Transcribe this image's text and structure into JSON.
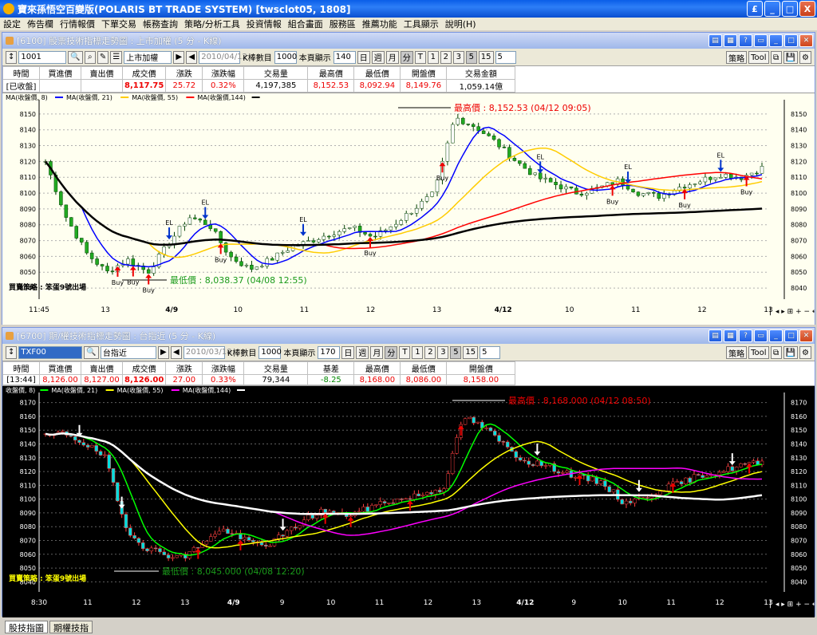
{
  "window": {
    "title": "寶來孫悟空百變版(POLARIS BT TRADE SYSTEM)  [twsclot05, 1808]",
    "buttons": [
      "£",
      "_",
      "□",
      "X"
    ]
  },
  "menu": [
    "設定",
    "佈告欄",
    "行情報價",
    "下單交易",
    "帳務查詢",
    "策略/分析工具",
    "投資情報",
    "組合畫面",
    "服務區",
    "推薦功能",
    "工具顯示",
    "說明(H)"
  ],
  "top": {
    "title": "[6100] 股票技術指標走勢圖 : 上市加權 (5 分 - K線)",
    "code": "1001",
    "name": "上市加權",
    "date": "2010/04/12",
    "kbar_label": "K棒數目",
    "kbar_value": "1000",
    "page_label": "本頁顯示",
    "page_value": "140",
    "periods": [
      "日",
      "週",
      "月",
      "分",
      "T",
      "1",
      "2",
      "3",
      "5",
      "15"
    ],
    "period_select": "5",
    "right_btns": [
      "策略",
      "Tool"
    ],
    "quote_headers": [
      "時間",
      "買進價",
      "賣出價",
      "成交價",
      "漲跌",
      "漲跌幅",
      "交易量",
      "最高價",
      "最低價",
      "開盤價",
      "交易金額"
    ],
    "quote_values": [
      "[已收盤]",
      "",
      "",
      "8,117.75",
      "25.72",
      "0.32%",
      "4,197,385",
      "8,152.53",
      "8,092.94",
      "8,149.76",
      "1,059.14億"
    ],
    "legend": [
      "MA(收盤價, 8)",
      "MA(收盤價, 21)",
      "MA(收盤價, 55)",
      "MA(收盤價,144)"
    ],
    "high_label": "最高價 : 8,152.53 (04/12 09:05)",
    "low_label": "最低價 : 8,038.37 (04/08 12:55)",
    "strategy_label": "買賣策略 : 笨蛋9號出場",
    "x_labels": [
      "11:45",
      "13",
      "4/9",
      "10",
      "11",
      "12",
      "13",
      "4/12",
      "10",
      "11",
      "12",
      "13"
    ],
    "y_ticks": [
      "8150",
      "8140",
      "8130",
      "8120",
      "8110",
      "8100",
      "8090",
      "8080",
      "8070",
      "8060",
      "8050",
      "8040"
    ],
    "signals": [
      "Buy",
      "Buy",
      "EL",
      "Buy",
      "EL",
      "EL",
      "Buy",
      "EL",
      "Buy",
      "EL",
      "EL",
      "Buy",
      "Buy",
      "EL",
      "Buy"
    ]
  },
  "bottom": {
    "title": "[6700] 期/權技術指標走勢圖 : 台指近 (5 分 - K線)",
    "code": "TXF00",
    "name": "台指近",
    "date": "2010/03/18",
    "kbar_label": "K棒數目",
    "kbar_value": "1000",
    "page_label": "本頁顯示",
    "page_value": "170",
    "periods": [
      "日",
      "週",
      "月",
      "分",
      "T",
      "1",
      "2",
      "3",
      "5",
      "15"
    ],
    "period_select": "5",
    "right_btns": [
      "策略",
      "Tool"
    ],
    "quote_headers": [
      "時間",
      "買進價",
      "賣出價",
      "成交價",
      "漲跌",
      "漲跌幅",
      "交易量",
      "基差",
      "最高價",
      "最低價",
      "開盤價"
    ],
    "quote_values": [
      "[13:44]",
      "8,126.00",
      "8,127.00",
      "8,126.00",
      "27.00",
      "0.33%",
      "79,344",
      "-8.25",
      "8,168.00",
      "8,086.00",
      "8,158.00"
    ],
    "legend": [
      "收盤價, 8)",
      "MA(收盤價, 21)",
      "MA(收盤價, 55)",
      "MA(收盤價,144)"
    ],
    "high_label": "最高價 : 8,168.000 (04/12 08:50)",
    "low_label": "最低價 : 8,045.000 (04/08 12:20)",
    "strategy_label": "買賣策略 : 笨蛋9號出場",
    "x_labels": [
      "8:30",
      "11",
      "12",
      "13",
      "4/9",
      "9",
      "10",
      "11",
      "12",
      "13",
      "4/12",
      "9",
      "10",
      "11",
      "12",
      "13"
    ],
    "y_ticks": [
      "8170",
      "8160",
      "8150",
      "8140",
      "8130",
      "8120",
      "8110",
      "8100",
      "8090",
      "8080",
      "8070",
      "8060",
      "8050",
      "8040"
    ]
  },
  "tabs": [
    "股技指圖",
    "期權技指"
  ],
  "colors": {
    "ma8": "#0000ff",
    "ma21": "#ffc800",
    "ma55": "#ff0000",
    "ma144": "#000000"
  }
}
